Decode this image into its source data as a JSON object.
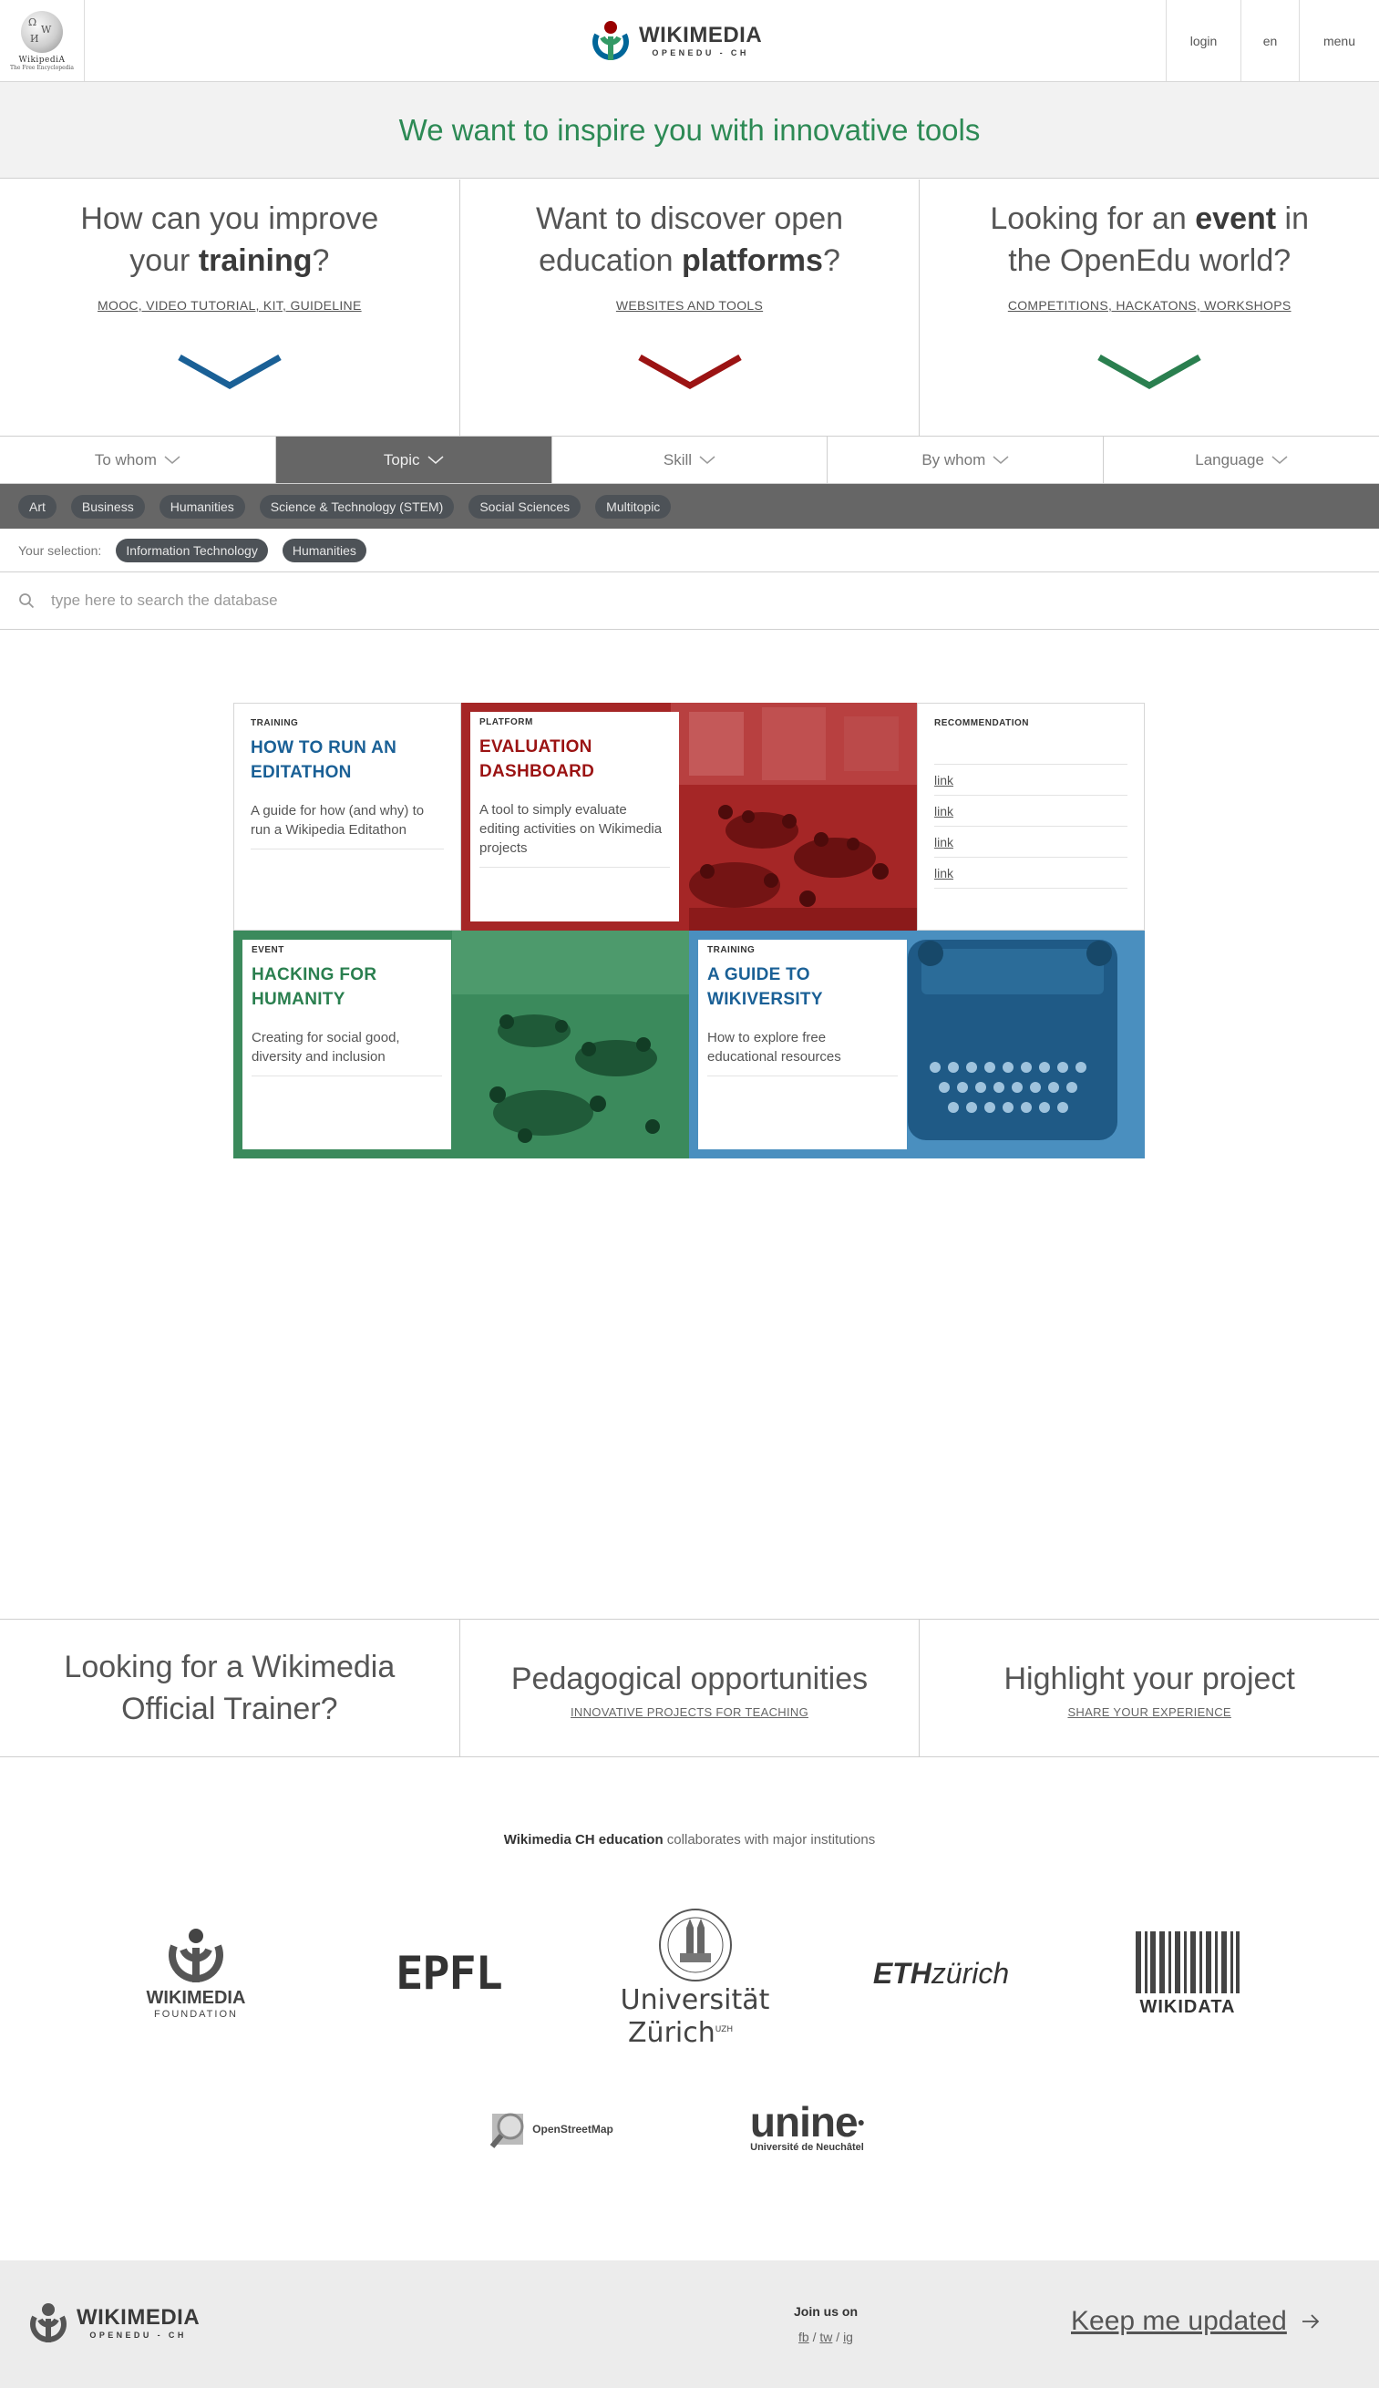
{
  "header": {
    "wikipedia_name": "WikipediA",
    "wikipedia_tagline": "The Free Encyclopedia",
    "brand_name": "WIKIMEDIA",
    "brand_sub": "OPENEDU - CH",
    "login": "login",
    "language": "en",
    "menu": "menu"
  },
  "banner": {
    "title": "We want to inspire you with innovative tools"
  },
  "intro": [
    {
      "line1": "How can you improve",
      "line2_pre": "your ",
      "line2_bold": "training",
      "line2_post": "?",
      "link": "MOOC, VIDEO TUTORIAL, KIT, GUIDELINE",
      "color": "#1a6096"
    },
    {
      "line1": "Want to discover open",
      "line2_pre": "education ",
      "line2_bold": "platforms",
      "line2_post": "?",
      "link": "WEBSITES AND TOOLS",
      "color": "#9b1313"
    },
    {
      "line1_pre": "Looking for an ",
      "line1_bold": "event",
      "line1_post": " in",
      "line2": "the OpenEdu world?",
      "link": "COMPETITIONS, HACKATONS, WORKSHOPS",
      "color": "#2a7f4f"
    }
  ],
  "tabs": [
    "To whom",
    "Topic",
    "Skill",
    "By whom",
    "Language"
  ],
  "topic_chips": [
    "Art",
    "Business",
    "Humanities",
    "Science & Technology (STEM)",
    "Social Sciences",
    "Multitopic"
  ],
  "selection": {
    "label": "Your selection:",
    "chips": [
      "Information Technology",
      "Humanities"
    ]
  },
  "search": {
    "placeholder": "type here to search the database"
  },
  "cards": {
    "c1": {
      "kicker": "TRAINING",
      "title": "HOW TO RUN AN EDITATHON",
      "desc": "A guide for how (and why) to run a Wikipedia Editathon",
      "color": "#1a6096"
    },
    "c2": {
      "kicker": "PLATFORM",
      "title": "EVALUATION DASHBOARD",
      "desc": "A tool to simply evaluate editing activities on Wikimedia projects",
      "color": "#9b1313"
    },
    "c3": {
      "kicker": "RECOMMENDATION",
      "links": [
        "link",
        "link",
        "link",
        "link"
      ]
    },
    "c4": {
      "kicker": "EVENT",
      "title": "HACKING FOR HUMANITY",
      "desc": "Creating for social good, diversity and inclusion",
      "color": "#2a7f4f"
    },
    "c5": {
      "kicker": "TRAINING",
      "title": "A GUIDE TO WIKIVERSITY",
      "desc": "How to explore free educational resources",
      "color": "#1a6096"
    }
  },
  "info": [
    {
      "title": "Looking for a Wikimedia Official Trainer?",
      "link": ""
    },
    {
      "title": "Pedagogical opportunities",
      "link": "INNOVATIVE PROJECTS FOR TEACHING"
    },
    {
      "title": "Highlight your project",
      "link": "SHARE YOUR EXPERIENCE"
    }
  ],
  "partners": {
    "intro_bold": "Wikimedia CH education",
    "intro_rest": " collaborates with major institutions",
    "wmf_line1": "WIKIMEDIA",
    "wmf_line2": "FOUNDATION",
    "epfl": "EPFL",
    "uzh_line1": "Universität",
    "uzh_line2": "Zürich",
    "uzh_sup": "UZH",
    "eth_bold": "ETH",
    "eth_rest": "zürich",
    "wikidata": "WIKIDATA",
    "osm": "OpenStreetMap",
    "unine": "unine",
    "unine_sub": "Université de Neuchâtel"
  },
  "footer": {
    "brand_name": "WIKIMEDIA",
    "brand_sub": "OPENEDU - CH",
    "join_title": "Join us on",
    "fb": "fb",
    "tw": "tw",
    "ig": "ig",
    "keep": "Keep me updated"
  }
}
